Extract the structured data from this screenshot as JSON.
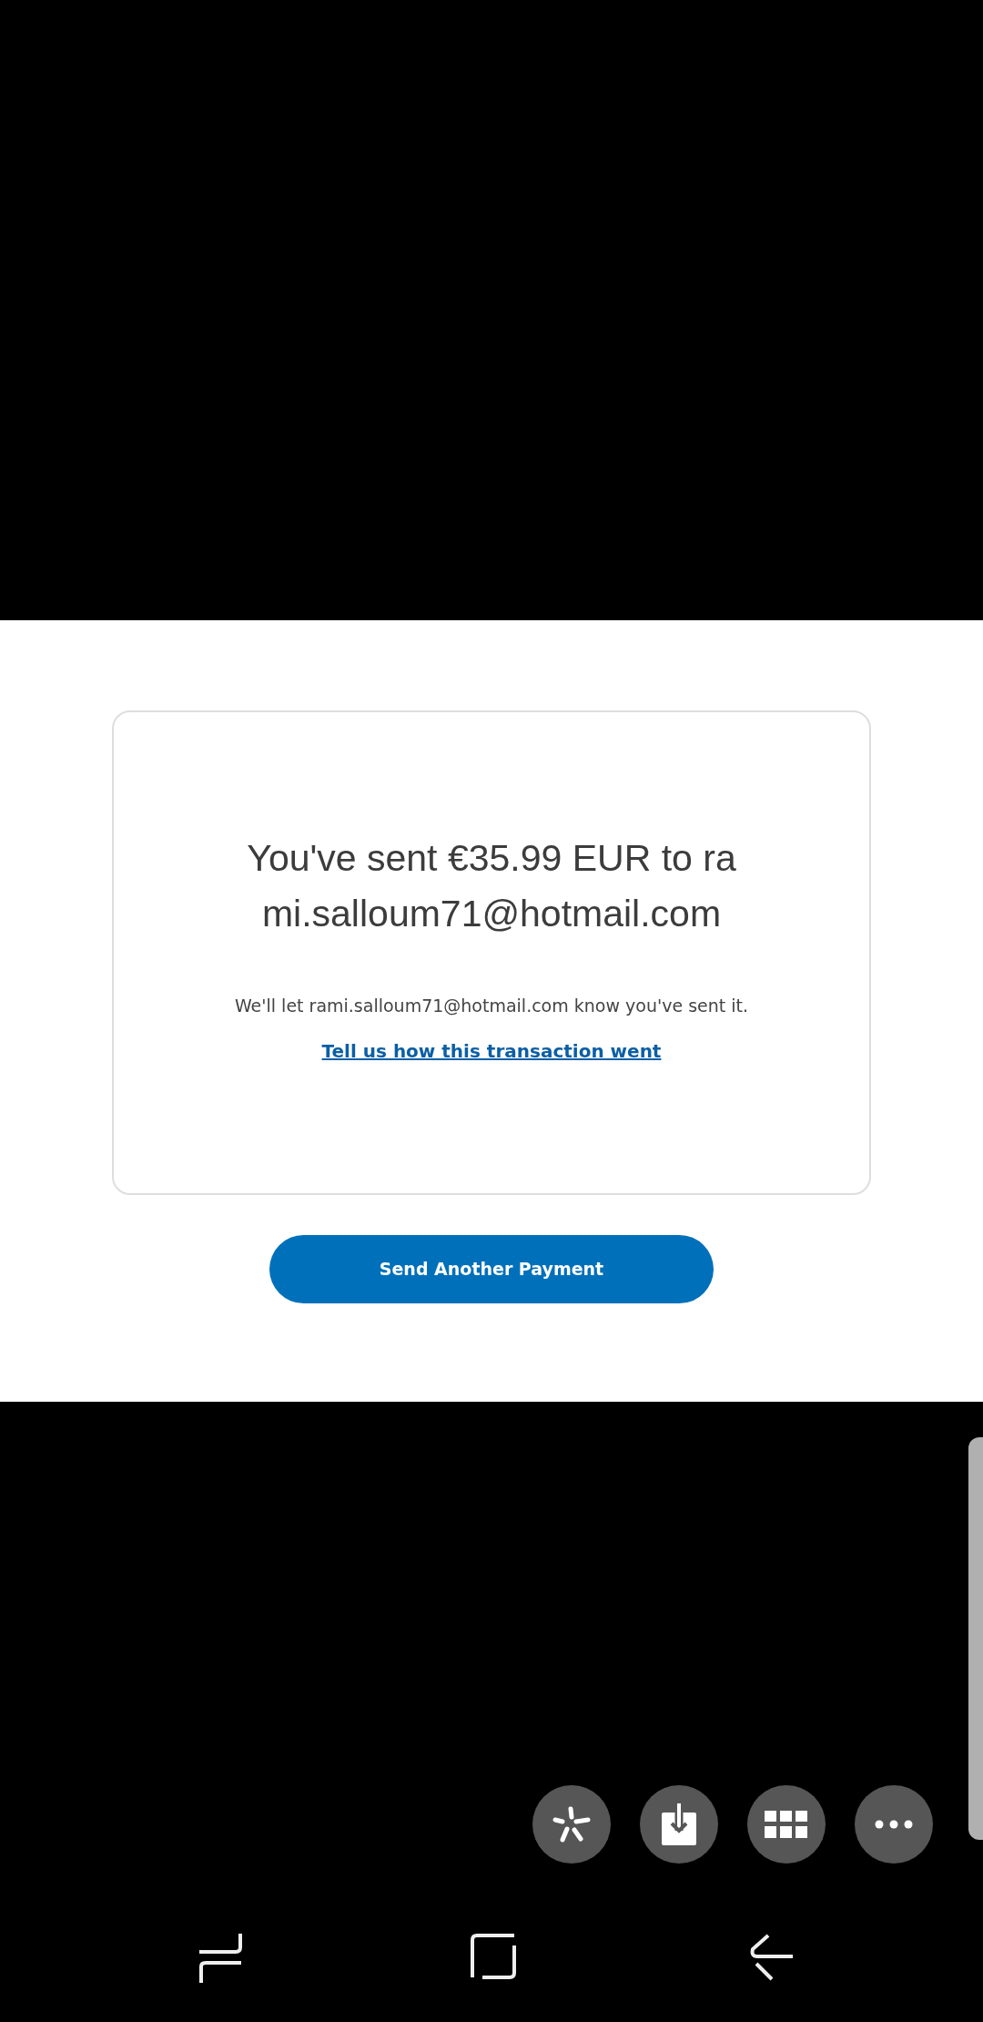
{
  "confirmation": {
    "heading": "You've sent €35.99 EUR to rami.salloum71@hotmail.com",
    "message": "We'll let rami.salloum71@hotmail.com know you've sent it.",
    "feedback_link": "Tell us how this transaction went"
  },
  "primary_button": {
    "label": "Send Another Payment"
  }
}
